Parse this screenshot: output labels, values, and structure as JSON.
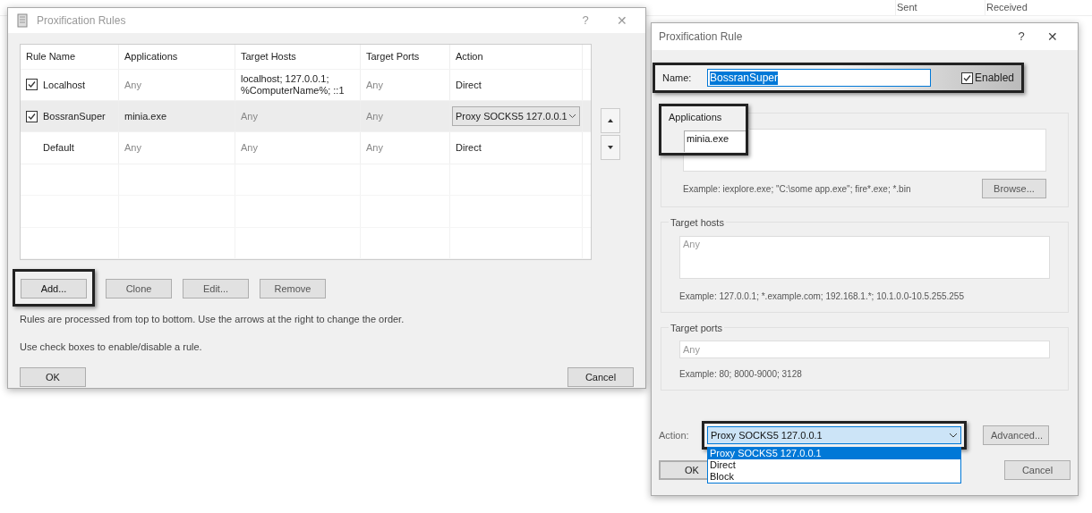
{
  "background_table": {
    "columns": [
      "Sent",
      "Received"
    ]
  },
  "rules_dialog": {
    "title": "Proxification Rules",
    "help": "?",
    "close": "✕",
    "columns": [
      "Rule Name",
      "Applications",
      "Target Hosts",
      "Target Ports",
      "Action"
    ],
    "rows": [
      {
        "kind": "rule",
        "checked": true,
        "selected": false,
        "name": "Localhost",
        "applications": {
          "text": "Any",
          "dim": true
        },
        "target_hosts": {
          "text": "localhost; 127.0.0.1; %ComputerName%; ::1",
          "dim": false
        },
        "target_ports": {
          "text": "Any",
          "dim": true
        },
        "action": "Direct",
        "action_dropdown": false
      },
      {
        "kind": "rule",
        "checked": true,
        "selected": true,
        "name": "BossranSuper",
        "applications": {
          "text": "minia.exe",
          "dim": false
        },
        "target_hosts": {
          "text": "Any",
          "dim": true
        },
        "target_ports": {
          "text": "Any",
          "dim": true
        },
        "action": "Proxy SOCKS5 127.0.0.1",
        "action_dropdown": true
      },
      {
        "kind": "default",
        "selected": false,
        "name": "Default",
        "applications": {
          "text": "Any",
          "dim": true
        },
        "target_hosts": {
          "text": "Any",
          "dim": true
        },
        "target_ports": {
          "text": "Any",
          "dim": true
        },
        "action": "Direct",
        "action_dropdown": false
      }
    ],
    "buttons": [
      {
        "label": "Add...",
        "highlighted": true
      },
      {
        "label": "Clone",
        "highlighted": false
      },
      {
        "label": "Edit...",
        "highlighted": false
      },
      {
        "label": "Remove",
        "highlighted": false
      }
    ],
    "notes": [
      "Rules are processed from top to bottom. Use the arrows at the right to change the order.",
      "Use check boxes to enable/disable a rule."
    ],
    "ok": "OK",
    "cancel": "Cancel"
  },
  "rule_dialog": {
    "title": "Proxification Rule",
    "help": "?",
    "close": "✕",
    "name_label": "Name:",
    "name_value": "BossranSuper",
    "enabled_label": "Enabled",
    "enabled": true,
    "applications": {
      "label": "Applications",
      "value": "minia.exe",
      "example": "Example: iexplore.exe; \"C:\\some app.exe\"; fire*.exe; *.bin",
      "button": "Browse..."
    },
    "target_hosts": {
      "label": "Target hosts",
      "placeholder": "Any",
      "example": "Example: 127.0.0.1; *.example.com; 192.168.1.*; 10.1.0.0-10.5.255.255"
    },
    "target_ports": {
      "label": "Target ports",
      "placeholder": "Any",
      "example": "Example: 80; 8000-9000; 3128"
    },
    "action_label": "Action:",
    "action_value": "Proxy SOCKS5 127.0.0.1",
    "action_options": [
      {
        "text": "Proxy SOCKS5 127.0.0.1",
        "selected": true
      },
      {
        "text": "Direct",
        "selected": false
      },
      {
        "text": "Block",
        "selected": false
      }
    ],
    "advanced": "Advanced...",
    "ok": "OK",
    "cancel": "Cancel"
  }
}
